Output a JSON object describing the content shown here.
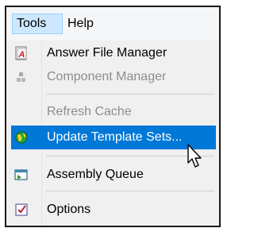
{
  "menubar": {
    "tools": "Tools",
    "help": "Help"
  },
  "menu": {
    "items": [
      {
        "label": "Answer File Manager",
        "icon": "answer-file-icon",
        "enabled": true
      },
      {
        "label": "Component Manager",
        "icon": "component-icon",
        "enabled": false
      },
      {
        "label": "Refresh Cache",
        "enabled": false
      },
      {
        "label": "Update Template Sets...",
        "icon": "update-globe-icon",
        "enabled": true,
        "highlighted": true
      },
      {
        "label": "Assembly Queue",
        "icon": "assembly-queue-icon",
        "enabled": true
      },
      {
        "label": "Options",
        "icon": "options-checkbox-icon",
        "enabled": true
      }
    ]
  },
  "colors": {
    "highlight": "#0078d7",
    "menu_bg": "#f0f0f0",
    "disabled_text": "#8d8d8d"
  }
}
